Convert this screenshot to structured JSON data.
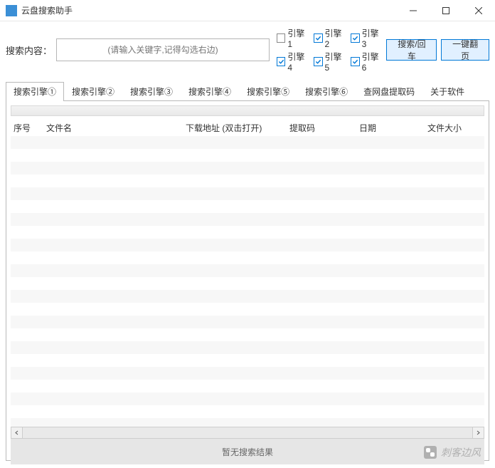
{
  "window": {
    "title": "云盘搜索助手"
  },
  "search": {
    "label": "搜索内容：",
    "placeholder": "(请输入关键字,记得勾选右边)",
    "engines": [
      {
        "label": "引擎1",
        "checked": false
      },
      {
        "label": "引擎2",
        "checked": true
      },
      {
        "label": "引擎3",
        "checked": true
      },
      {
        "label": "引擎4",
        "checked": true
      },
      {
        "label": "引擎5",
        "checked": true
      },
      {
        "label": "引擎6",
        "checked": true
      }
    ],
    "search_btn": "搜索/回车",
    "page_btn": "一键翻页"
  },
  "tabs": [
    {
      "label": "搜索引擎①",
      "active": true
    },
    {
      "label": "搜索引擎②",
      "active": false
    },
    {
      "label": "搜索引擎③",
      "active": false
    },
    {
      "label": "搜索引擎④",
      "active": false
    },
    {
      "label": "搜索引擎⑤",
      "active": false
    },
    {
      "label": "搜索引擎⑥",
      "active": false
    },
    {
      "label": "查网盘提取码",
      "active": false
    },
    {
      "label": "关于软件",
      "active": false
    }
  ],
  "table": {
    "columns": [
      {
        "label": "序号",
        "width": 46
      },
      {
        "label": "文件名",
        "width": 196
      },
      {
        "label": "下载地址 (双击打开)",
        "width": 146
      },
      {
        "label": "提取码",
        "width": 98
      },
      {
        "label": "日期",
        "width": 96
      },
      {
        "label": "文件大小",
        "width": 70
      }
    ],
    "rows": [],
    "empty_text": "暂无搜索结果"
  },
  "watermark": "刺客边风"
}
